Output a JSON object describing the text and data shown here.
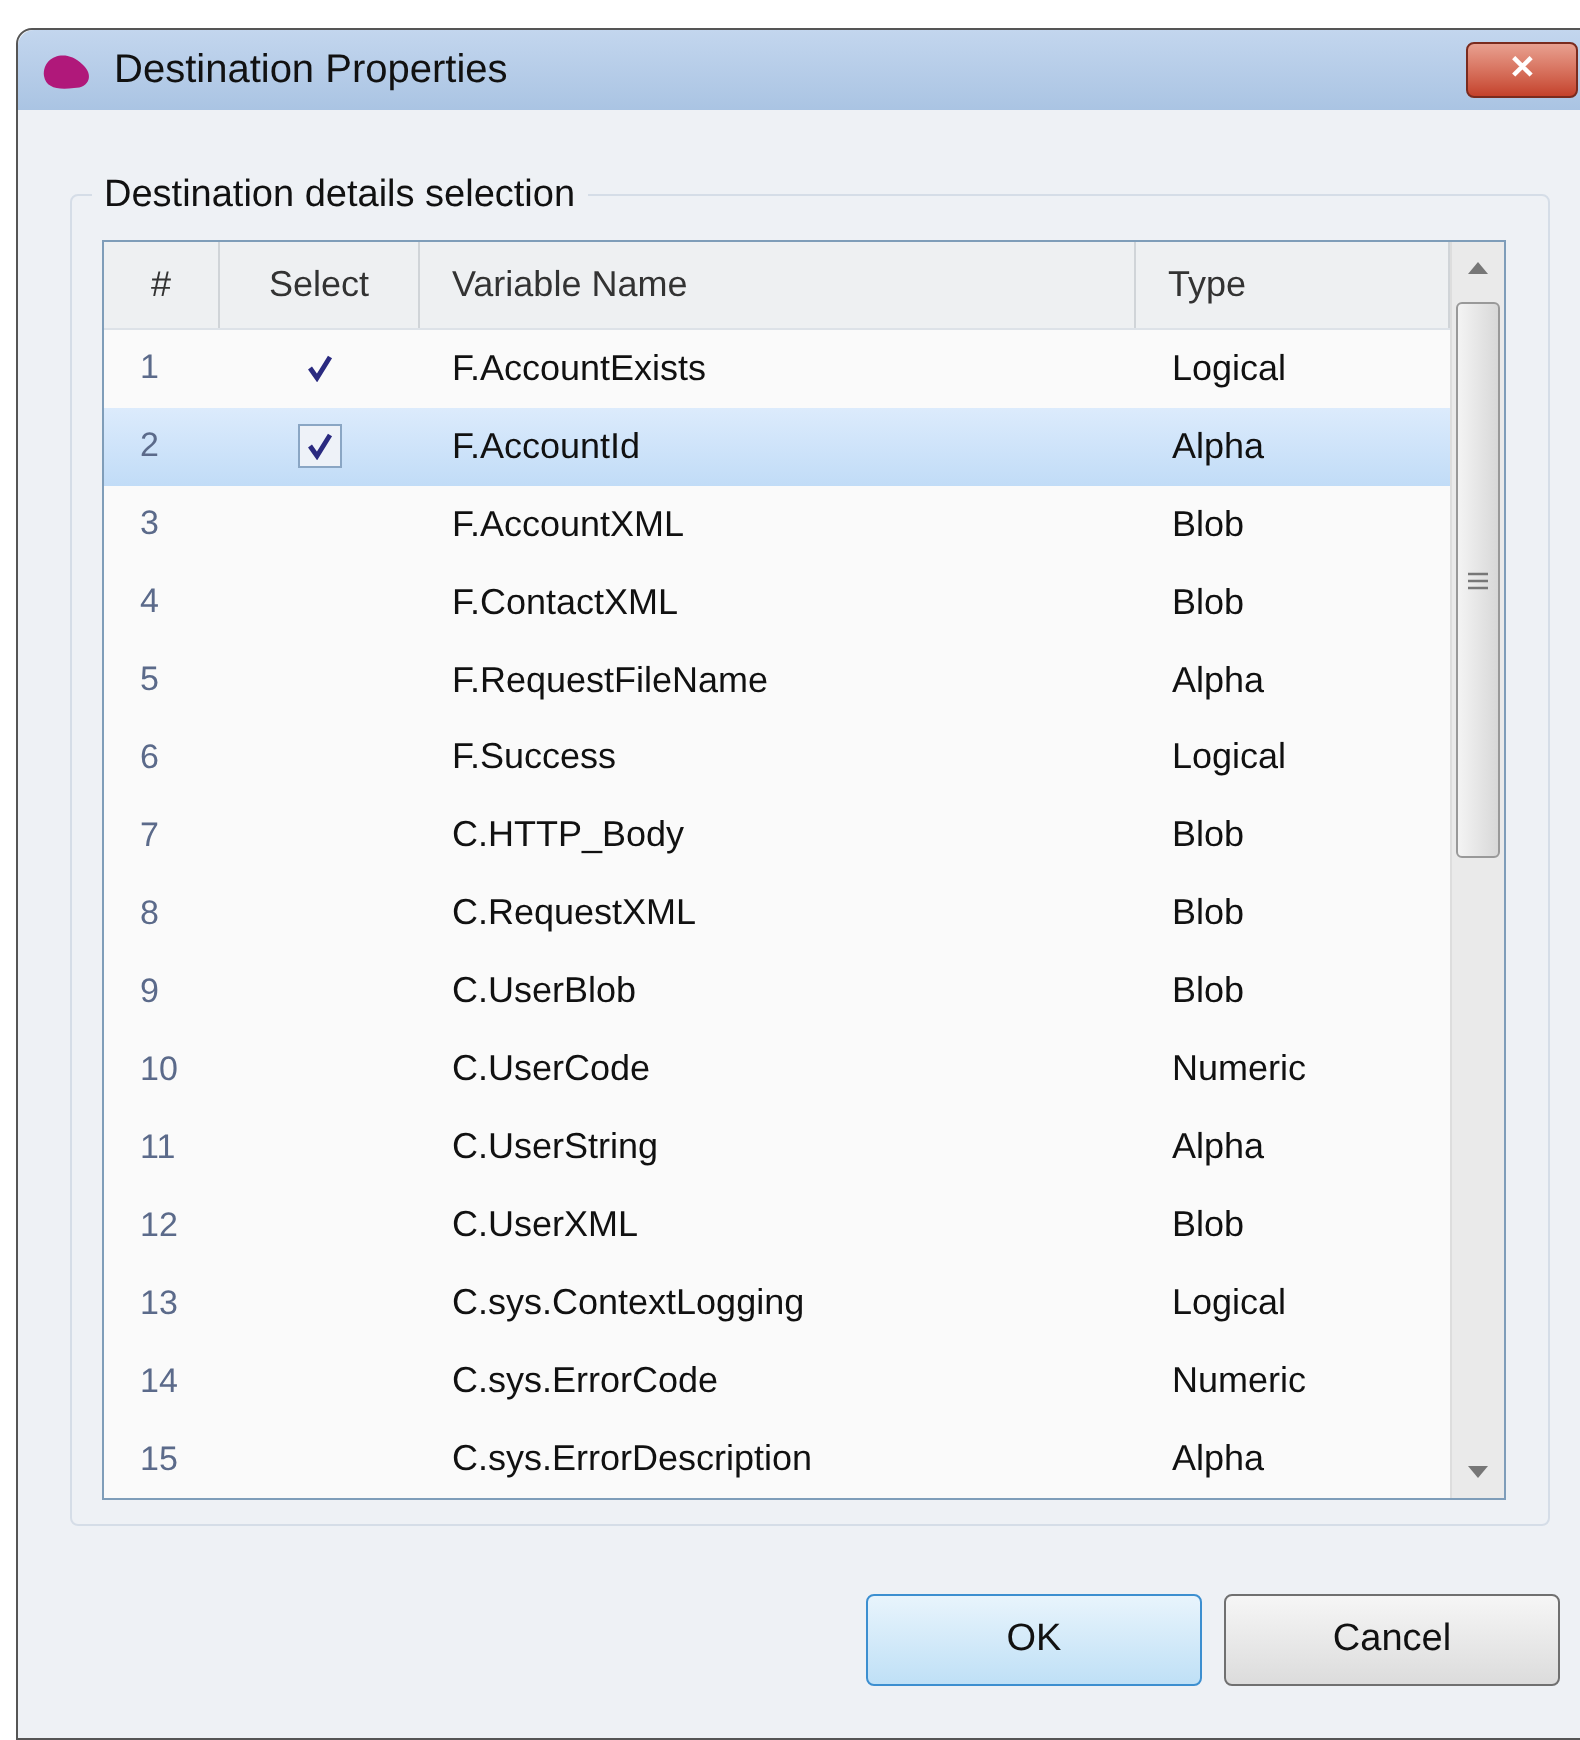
{
  "window": {
    "title": "Destination Properties",
    "close": "✕"
  },
  "group": {
    "title": "Destination details selection"
  },
  "table": {
    "columns": [
      "#",
      "Select",
      "Variable Name",
      "Type"
    ],
    "rows": [
      {
        "number": "1",
        "checked": true,
        "selected": false,
        "name": "F.AccountExists",
        "type": "Logical"
      },
      {
        "number": "2",
        "checked": true,
        "selected": true,
        "name": "F.AccountId",
        "type": "Alpha"
      },
      {
        "number": "3",
        "checked": false,
        "selected": false,
        "name": "F.AccountXML",
        "type": "Blob"
      },
      {
        "number": "4",
        "checked": false,
        "selected": false,
        "name": "F.ContactXML",
        "type": "Blob"
      },
      {
        "number": "5",
        "checked": false,
        "selected": false,
        "name": "F.RequestFileName",
        "type": "Alpha"
      },
      {
        "number": "6",
        "checked": false,
        "selected": false,
        "name": "F.Success",
        "type": "Logical"
      },
      {
        "number": "7",
        "checked": false,
        "selected": false,
        "name": "C.HTTP_Body",
        "type": "Blob"
      },
      {
        "number": "8",
        "checked": false,
        "selected": false,
        "name": "C.RequestXML",
        "type": "Blob"
      },
      {
        "number": "9",
        "checked": false,
        "selected": false,
        "name": "C.UserBlob",
        "type": "Blob"
      },
      {
        "number": "10",
        "checked": false,
        "selected": false,
        "name": "C.UserCode",
        "type": "Numeric"
      },
      {
        "number": "11",
        "checked": false,
        "selected": false,
        "name": "C.UserString",
        "type": "Alpha"
      },
      {
        "number": "12",
        "checked": false,
        "selected": false,
        "name": "C.UserXML",
        "type": "Blob"
      },
      {
        "number": "13",
        "checked": false,
        "selected": false,
        "name": "C.sys.ContextLogging",
        "type": "Logical"
      },
      {
        "number": "14",
        "checked": false,
        "selected": false,
        "name": "C.sys.ErrorCode",
        "type": "Numeric"
      },
      {
        "number": "15",
        "checked": false,
        "selected": false,
        "name": "C.sys.ErrorDescription",
        "type": "Alpha"
      }
    ]
  },
  "buttons": [
    {
      "label": "OK",
      "selected": true
    },
    {
      "label": "Cancel",
      "selected": false
    }
  ]
}
